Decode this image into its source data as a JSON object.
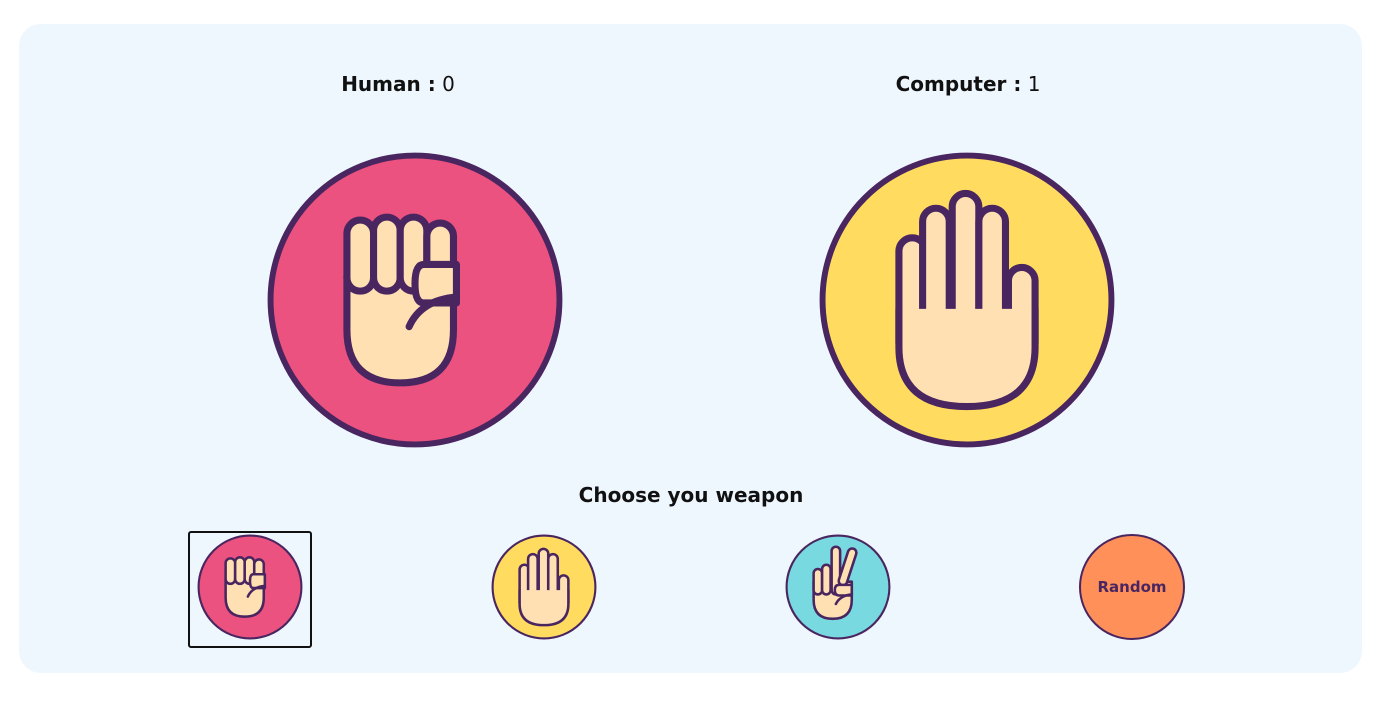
{
  "scores": {
    "human_label": "Human :",
    "human_value": "0",
    "computer_label": "Computer :",
    "computer_value": "1"
  },
  "prompt": "Choose you weapon",
  "human_choice": "rock",
  "computer_choice": "paper",
  "weapons": [
    {
      "name": "rock",
      "color": "#ec5280"
    },
    {
      "name": "paper",
      "color": "#ffdc5f"
    },
    {
      "name": "scissors",
      "color": "#79d9e0"
    },
    {
      "name": "random",
      "label": "Random",
      "color": "#ff905a"
    }
  ],
  "colors": {
    "outline": "#4a2660",
    "skin": "#ffe0b2",
    "panel": "#eff7fe"
  }
}
